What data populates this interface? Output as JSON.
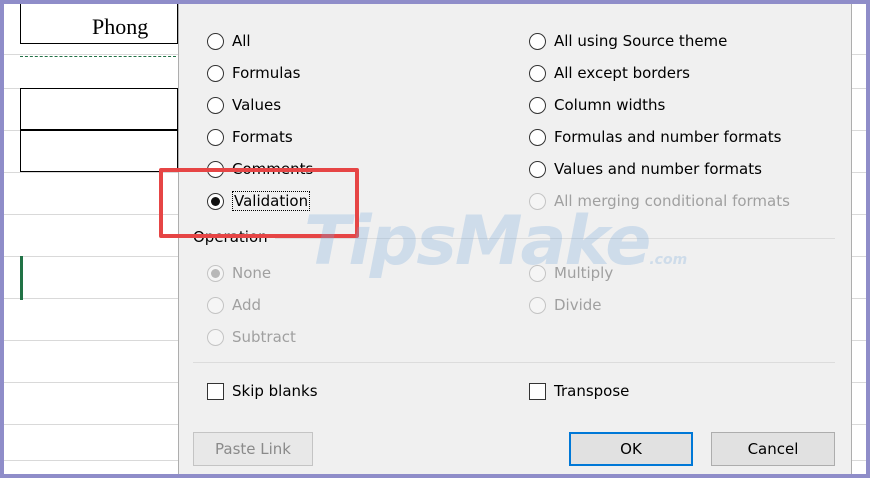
{
  "sheet": {
    "cell_text": "Phong"
  },
  "paste": {
    "left": [
      {
        "label": "All",
        "key": "A",
        "checked": false,
        "disabled": false
      },
      {
        "label": "Formulas",
        "key": "F",
        "checked": false,
        "disabled": false
      },
      {
        "label": "Values",
        "key": "V",
        "checked": false,
        "disabled": false
      },
      {
        "label": "Formats",
        "key": "t",
        "checked": false,
        "disabled": false
      },
      {
        "label": "Comments",
        "key": "C",
        "checked": false,
        "disabled": false
      },
      {
        "label": "Validation",
        "key": "n",
        "checked": true,
        "disabled": false
      }
    ],
    "right": [
      {
        "label": "All using Source theme",
        "key": "h",
        "checked": false,
        "disabled": false
      },
      {
        "label": "All except borders",
        "key": "x",
        "checked": false,
        "disabled": false
      },
      {
        "label": "Column widths",
        "key": "w",
        "checked": false,
        "disabled": false
      },
      {
        "label": "Formulas and number formats",
        "key": "R",
        "checked": false,
        "disabled": false
      },
      {
        "label": "Values and number formats",
        "key": "U",
        "checked": false,
        "disabled": false
      },
      {
        "label": "All merging conditional formats",
        "key": "G",
        "checked": false,
        "disabled": true
      }
    ]
  },
  "operation": {
    "label": "Operation",
    "left": [
      {
        "label": "None",
        "checked": true,
        "disabled": true
      },
      {
        "label": "Add",
        "checked": false,
        "disabled": true
      },
      {
        "label": "Subtract",
        "checked": false,
        "disabled": true
      }
    ],
    "right": [
      {
        "label": "Multiply",
        "checked": false,
        "disabled": true
      },
      {
        "label": "Divide",
        "checked": false,
        "disabled": true
      }
    ]
  },
  "options": {
    "skip_blanks": "Skip blanks",
    "transpose": "Transpose"
  },
  "buttons": {
    "paste_link": "Paste Link",
    "ok": "OK",
    "cancel": "Cancel"
  },
  "watermark": {
    "text": "TipsMake",
    "suffix": ".com"
  }
}
